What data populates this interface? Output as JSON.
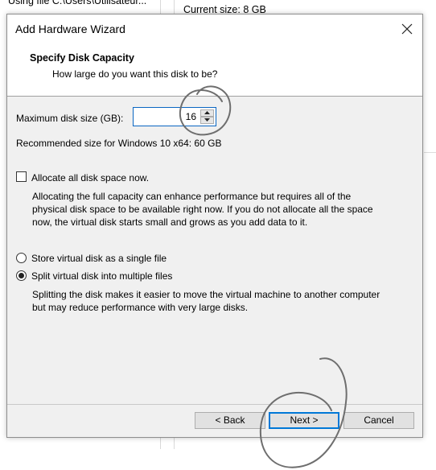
{
  "background": {
    "left_text": "Using file C:\\Users\\Utilisateur...",
    "right_text": "Current size: 8 GB"
  },
  "dialog": {
    "title": "Add Hardware Wizard",
    "header_title": "Specify Disk Capacity",
    "header_subtitle": "How large do you want this disk to be?"
  },
  "capacity": {
    "label": "Maximum disk size (GB):",
    "value": "16",
    "recommended": "Recommended size for Windows 10 x64: 60 GB"
  },
  "allocate": {
    "label": "Allocate all disk space now.",
    "checked": false,
    "desc_lines": [
      "Allocating the full capacity can enhance performance but requires all of the",
      "physical disk space to be available right now. If you do not allocate all the space",
      "now, the virtual disk starts small and grows as you add data to it."
    ]
  },
  "storage": {
    "single_label": "Store virtual disk as a single file",
    "split_label": "Split virtual disk into multiple files",
    "selected": "split",
    "desc_lines": [
      "Splitting the disk makes it easier to move the virtual machine to another computer",
      "but may reduce performance with very large disks."
    ]
  },
  "buttons": {
    "back": "< Back",
    "next": "Next >",
    "cancel": "Cancel"
  }
}
